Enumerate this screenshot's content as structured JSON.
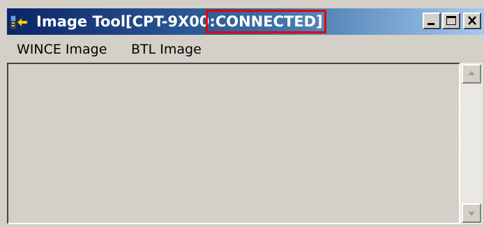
{
  "window": {
    "title_prefix": "Image Tool[CPT-9X00",
    "title_status": ":CONNECTED]",
    "icon": "app-device-arrow-icon",
    "controls": {
      "minimize_icon": "minimize-icon",
      "maximize_icon": "maximize-icon",
      "close_icon": "close-icon"
    },
    "colors": {
      "titlebar_start": "#0a246a",
      "titlebar_end": "#a6caf0",
      "highlight_box": "#e30000",
      "face": "#d4d0c8"
    }
  },
  "menu": {
    "items": [
      {
        "label": "WINCE Image"
      },
      {
        "label": "BTL Image"
      }
    ]
  },
  "scrollbar": {
    "up_icon": "scroll-up-arrow-icon",
    "down_icon": "scroll-down-arrow-icon"
  }
}
